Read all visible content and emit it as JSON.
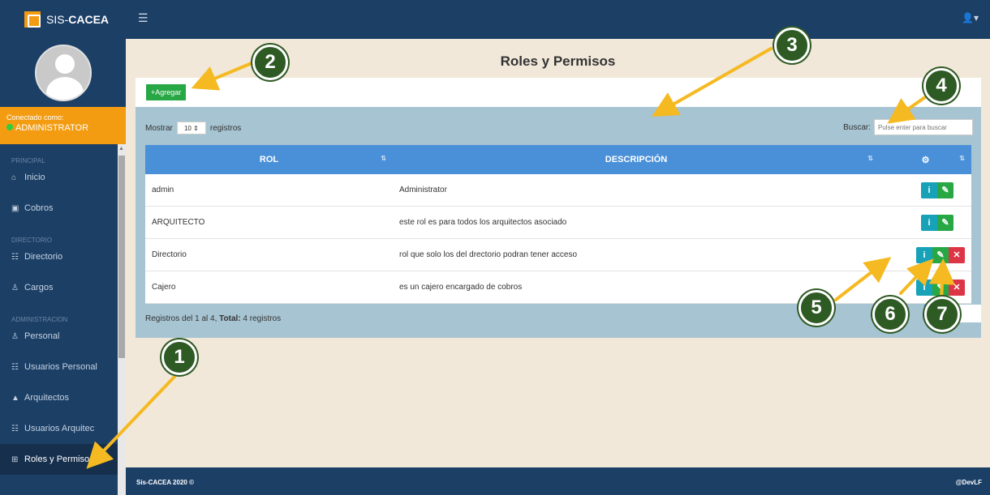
{
  "brand": {
    "prefix": "SIS-",
    "name": "CACEA"
  },
  "sidebar": {
    "connected_label": "Conectado como:",
    "user": "ADMINISTRATOR",
    "sections": {
      "principal": "PRINCIPAL",
      "directorio": "DIRECTORIO",
      "administracion": "ADMINISTRACION"
    },
    "items": [
      {
        "label": "Inicio",
        "icon": "home-icon"
      },
      {
        "label": "Cobros",
        "icon": "money-icon"
      },
      {
        "label": "Directorio",
        "icon": "users-icon"
      },
      {
        "label": "Cargos",
        "icon": "user-icon"
      },
      {
        "label": "Personal",
        "icon": "user-icon"
      },
      {
        "label": "Usuarios Personal",
        "icon": "users-icon"
      },
      {
        "label": "Arquitectos",
        "icon": "graduation-cap-icon"
      },
      {
        "label": "Usuarios Arquitec",
        "icon": "users-icon"
      },
      {
        "label": "Roles y Permisos",
        "icon": "table-icon"
      }
    ]
  },
  "main": {
    "title": "Roles y Permisos",
    "add_label": "+Agregar",
    "show_prefix": "Mostrar",
    "page_size": "10",
    "show_suffix": "registros",
    "search_label": "Buscar:",
    "search_placeholder": "Pulse enter para buscar",
    "columns": {
      "rol": "ROL",
      "descripcion": "DESCRIPCIÓN"
    },
    "rows": [
      {
        "rol": "admin",
        "descripcion": "Administrator"
      },
      {
        "rol": "ARQUITECTO",
        "descripcion": "este rol es para todos los arquitectos asociado"
      },
      {
        "rol": "Directorio",
        "descripcion": "rol que solo los del drectorio podran tener acceso"
      },
      {
        "rol": "Cajero",
        "descripcion": "es un cajero encargado de cobros"
      }
    ],
    "info_prefix": "Registros del 1 al 4, ",
    "info_total_label": "Total:",
    "info_total": " 4 registros"
  },
  "footer": {
    "left": "Sis-CACEA 2020 ©",
    "right": "@DevLF"
  },
  "callouts": [
    "1",
    "2",
    "3",
    "4",
    "5",
    "6",
    "7"
  ],
  "colors": {
    "navy": "#1c3f66",
    "orange": "#f39c12",
    "header_blue": "#4a90d9",
    "panel": "#a7c4d2",
    "arrow": "#f5b921",
    "callout_green": "#2e5a24"
  }
}
